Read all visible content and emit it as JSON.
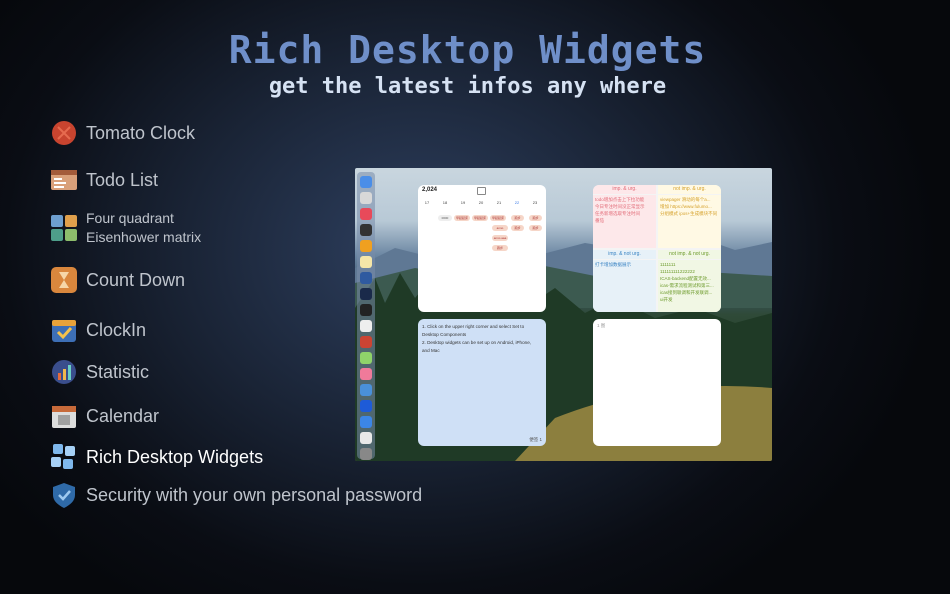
{
  "header": {
    "title": "Rich Desktop Widgets",
    "subtitle": "get the latest infos any where"
  },
  "features": [
    {
      "label": "Tomato Clock",
      "icon": "tomato-icon"
    },
    {
      "label": "Todo List",
      "icon": "todo-list-icon"
    },
    {
      "label": "Four quadrant",
      "label2": "Eisenhower matrix",
      "icon": "quadrant-icon"
    },
    {
      "label": "Count Down",
      "icon": "hourglass-icon"
    },
    {
      "label": "ClockIn",
      "icon": "clockin-icon"
    },
    {
      "label": "Statistic",
      "icon": "statistic-icon"
    },
    {
      "label": "Calendar",
      "icon": "calendar-icon"
    },
    {
      "label": "Rich Desktop Widgets",
      "icon": "widgets-icon",
      "active": true
    },
    {
      "label": "Security with your own personal password",
      "icon": "shield-icon"
    }
  ],
  "screenshot": {
    "calendar_widget": {
      "year": "2,024",
      "days": [
        "17",
        "18",
        "19",
        "20",
        "21",
        "22",
        "23"
      ],
      "chips": [
        "0000",
        "早起起床",
        "早起起床",
        "早起起床",
        "跑步",
        "跑步",
        "anno",
        "跑步",
        "跑步",
        "anno aaa",
        "跑步"
      ]
    },
    "quadrant_widget": {
      "q1_title": "imp. & urg.",
      "q2_title": "not imp. & urg.",
      "q3_title": "imp. & not urg.",
      "q4_title": "not imp. & not urg.",
      "q1_lines": [
        "todo增加点击上下拉功能",
        "今日专注时间没正常显示",
        "任务新增选取专注时间",
        "番茄"
      ],
      "q2_lines": [
        "viewpager 滑动的每个a...",
        "增加 https://www.fulumo...",
        "分组模式 ipos+生成模块不同"
      ],
      "q3_lines": [
        "打卡增加数据展示"
      ],
      "q4_lines": [
        "1111111",
        "111111111222222",
        "ICAS-backend配置无效...",
        "icas-需求流程测试和第三...",
        "icas接到联调和开发联调...",
        "ui开发"
      ]
    },
    "note_widget": {
      "lines": [
        "1. Click on the upper right corner and select Set to",
        "Desktop Components",
        "2. Desktop widgets can be set up on Android, iPhone,",
        "and Mac"
      ],
      "footer": "便签 1"
    },
    "empty_widget": {
      "tag": "1 图"
    }
  },
  "colors": {
    "title": "#6f8fc9",
    "subtitle": "#d6e2f3",
    "q1_bg": "#fde8ea",
    "q2_bg": "#fff9e4",
    "q3_bg": "#e7f1f8",
    "q4_bg": "#f1f7e4",
    "note_bg": "#cfe0f6"
  }
}
